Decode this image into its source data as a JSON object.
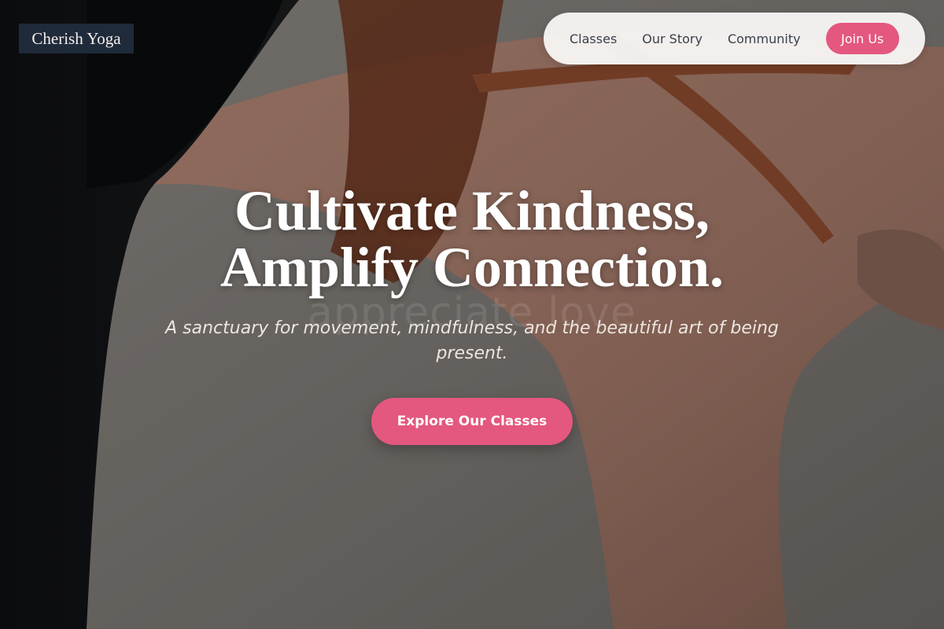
{
  "brand": {
    "name": "Cherish Yoga"
  },
  "nav": {
    "links": [
      {
        "label": "Classes"
      },
      {
        "label": "Our Story"
      },
      {
        "label": "Community"
      }
    ],
    "cta_label": "Join Us"
  },
  "hero": {
    "headline_line1": "Cultivate Kindness,",
    "headline_line2": "Amplify Connection.",
    "watermark": "appreciate love",
    "subtitle": "A sanctuary for movement, mindfulness, and the beautiful art of being present.",
    "cta_label": "Explore Our Classes",
    "image": "hero-photo"
  },
  "colors": {
    "accent": "#e4577f",
    "logo_bg": "#1f2a3b",
    "nav_bg": "#f8f7f6",
    "text_light": "#ffffff"
  }
}
